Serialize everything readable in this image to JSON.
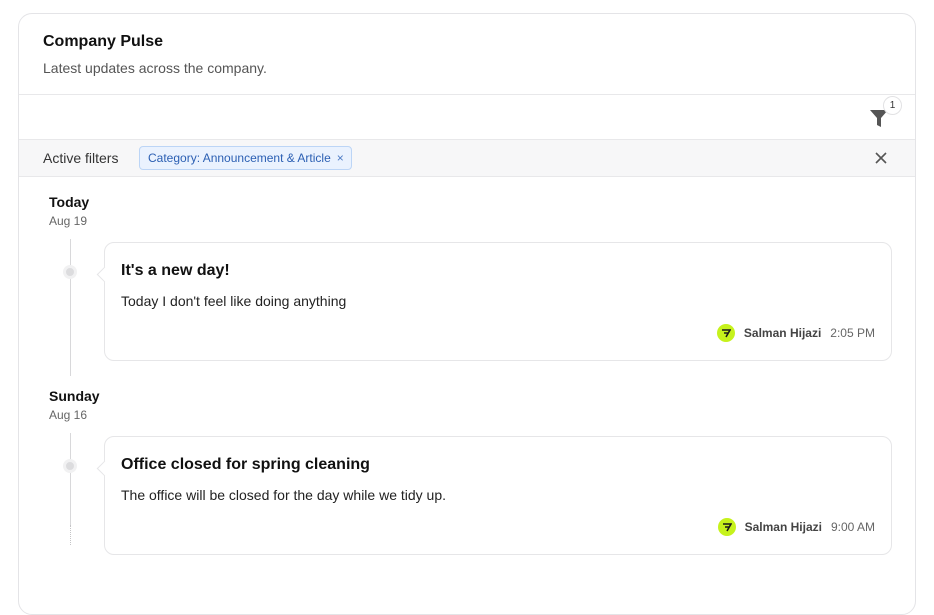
{
  "header": {
    "title": "Company Pulse",
    "subtitle": "Latest updates across the company."
  },
  "toolbar": {
    "filter_icon": "filter-icon",
    "filter_count": "1"
  },
  "filters": {
    "label": "Active filters",
    "chips": [
      {
        "label": "Category: Announcement & Article",
        "remove_icon": "close-icon"
      }
    ],
    "clear_icon": "close-icon"
  },
  "groups": [
    {
      "day": "Today",
      "date": "Aug 19",
      "posts": [
        {
          "title": "It's a new day!",
          "body": "Today I don't feel like doing anything",
          "author": "Salman Hijazi",
          "time": "2:05 PM"
        }
      ]
    },
    {
      "day": "Sunday",
      "date": "Aug 16",
      "posts": [
        {
          "title": "Office closed for spring cleaning",
          "body": "The office will be closed for the day while we tidy up.",
          "author": "Salman Hijazi",
          "time": "9:00 AM"
        }
      ]
    }
  ],
  "colors": {
    "avatar": "#c6f21c",
    "chip_bg": "#eaf2fe",
    "chip_text": "#2b5fb3"
  }
}
